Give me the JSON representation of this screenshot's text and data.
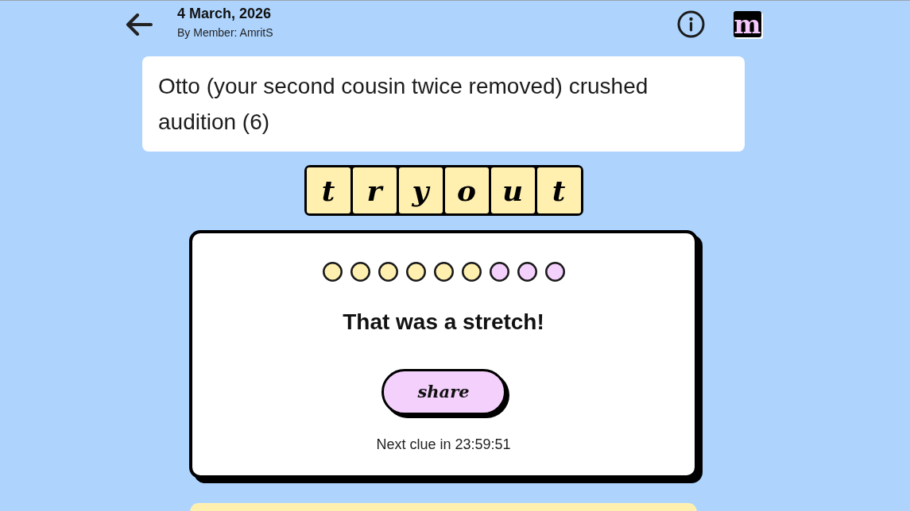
{
  "header": {
    "date": "4 March, 2026",
    "byline": "By Member: AmritS",
    "logo": "m"
  },
  "clue": {
    "text": "Otto (your second cousin twice removed) crushed audition (6)"
  },
  "answer": {
    "letters": [
      "t",
      "r",
      "y",
      "o",
      "u",
      "t"
    ]
  },
  "result": {
    "dots": [
      {
        "color": "#fff0b0"
      },
      {
        "color": "#fff0b0"
      },
      {
        "color": "#fff0b0"
      },
      {
        "color": "#fff0b0"
      },
      {
        "color": "#fff0b0"
      },
      {
        "color": "#fff0b0"
      },
      {
        "color": "#f4d0fc"
      },
      {
        "color": "#f4d0fc"
      },
      {
        "color": "#f4d0fc"
      }
    ],
    "message": "That was a stretch!",
    "share_button": "share",
    "countdown": "Next clue in 23:59:51"
  }
}
